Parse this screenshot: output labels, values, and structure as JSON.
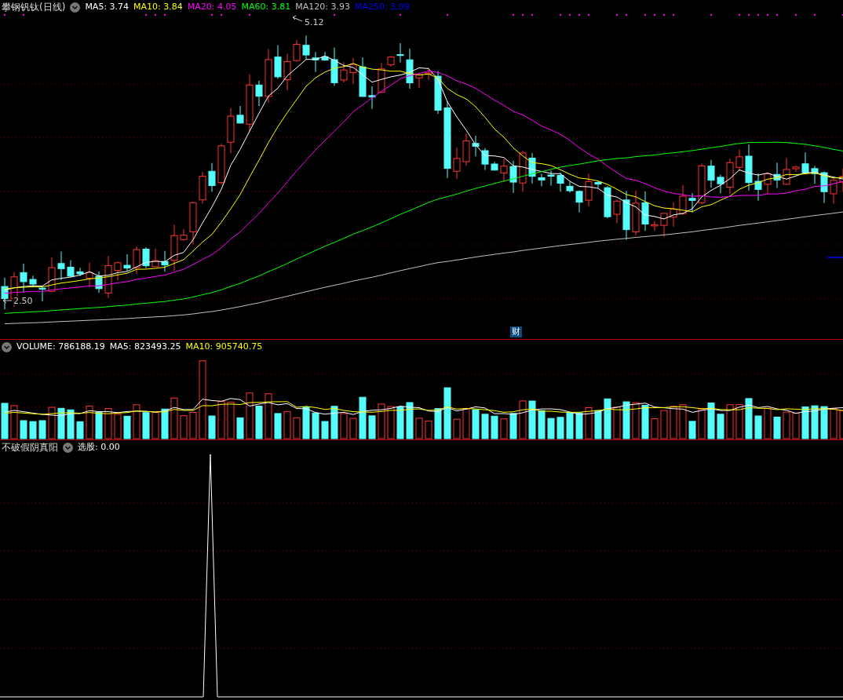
{
  "main_panel": {
    "title": "攀钢钒钛(日线)",
    "legend": [
      {
        "label": "MA5: 3.74",
        "color": "#ffffff"
      },
      {
        "label": "MA10: 3.84",
        "color": "#ffff00"
      },
      {
        "label": "MA20: 4.05",
        "color": "#ff00ff"
      },
      {
        "label": "MA60: 3.81",
        "color": "#00ff00"
      },
      {
        "label": "MA120: 3.93",
        "color": "#c0c0c0"
      },
      {
        "label": "MA250: 3.09",
        "color": "#0000ff"
      }
    ],
    "high_label": "5.12",
    "low_label": "2.50",
    "badge": "财"
  },
  "volume_panel": {
    "legend": [
      {
        "label": "VOLUME: 786188.19",
        "color": "#ffffff"
      },
      {
        "label": "MA5: 823493.25",
        "color": "#ffffff"
      },
      {
        "label": "MA10: 905740.75",
        "color": "#ffff00"
      }
    ]
  },
  "indicator_panel": {
    "title": "不破假阴真阳",
    "legend": [
      {
        "label": "选股: 0.00",
        "color": "#ffffff"
      }
    ]
  }
}
